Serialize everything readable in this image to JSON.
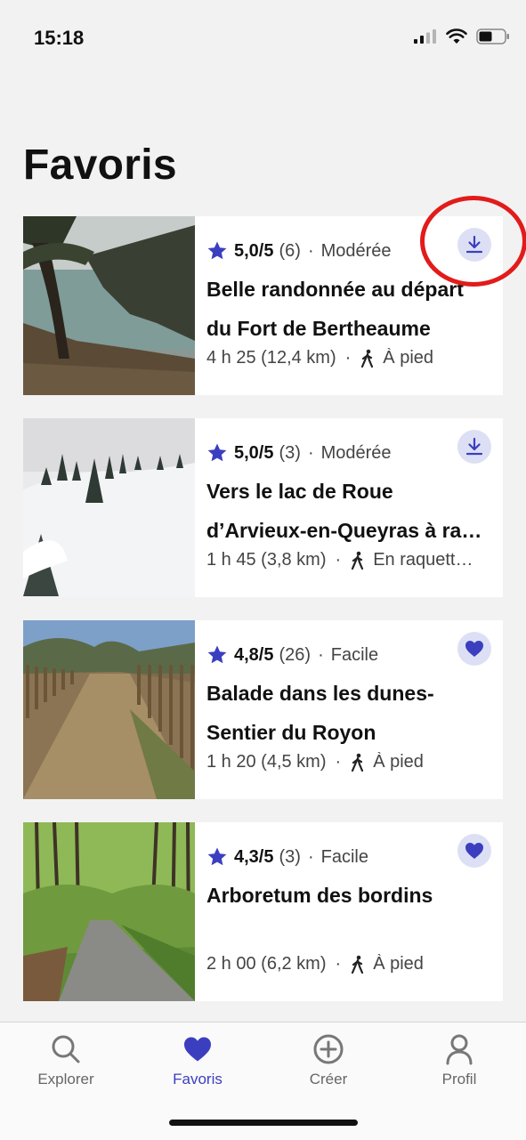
{
  "status_bar": {
    "time": "15:18"
  },
  "page": {
    "title": "Favoris"
  },
  "colors": {
    "accent": "#3b3fbf",
    "highlight": "#e21b1b"
  },
  "cards": [
    {
      "rating": "5,0/5",
      "reviews": "(6)",
      "difficulty": "Modérée",
      "title_lines": [
        "Belle randonnée au départ",
        "du Fort de Bertheaume"
      ],
      "duration": "4 h 25 (12,4 km)",
      "mode": "À pied",
      "action_icon": "download-icon"
    },
    {
      "rating": "5,0/5",
      "reviews": "(3)",
      "difficulty": "Modérée",
      "title_lines": [
        "Vers le lac de Roue",
        "d’Arvieux-en-Queyras à ra…"
      ],
      "duration": "1 h 45 (3,8 km)",
      "mode": "En raquett…",
      "action_icon": "download-icon"
    },
    {
      "rating": "4,8/5",
      "reviews": "(26)",
      "difficulty": "Facile",
      "title_lines": [
        "Balade dans les dunes-",
        "Sentier du Royon"
      ],
      "duration": "1 h 20 (4,5 km)",
      "mode": "À pied",
      "action_icon": "heart-icon"
    },
    {
      "rating": "4,3/5",
      "reviews": "(3)",
      "difficulty": "Facile",
      "title_lines": [
        "Arboretum des bordins",
        ""
      ],
      "duration": "2 h 00 (6,2 km)",
      "mode": "À pied",
      "action_icon": "heart-icon"
    }
  ],
  "tabs": [
    {
      "label": "Explorer",
      "icon": "search-icon"
    },
    {
      "label": "Favoris",
      "icon": "heart-icon",
      "active": true
    },
    {
      "label": "Créer",
      "icon": "plus-circle-icon"
    },
    {
      "label": "Profil",
      "icon": "user-icon"
    }
  ]
}
